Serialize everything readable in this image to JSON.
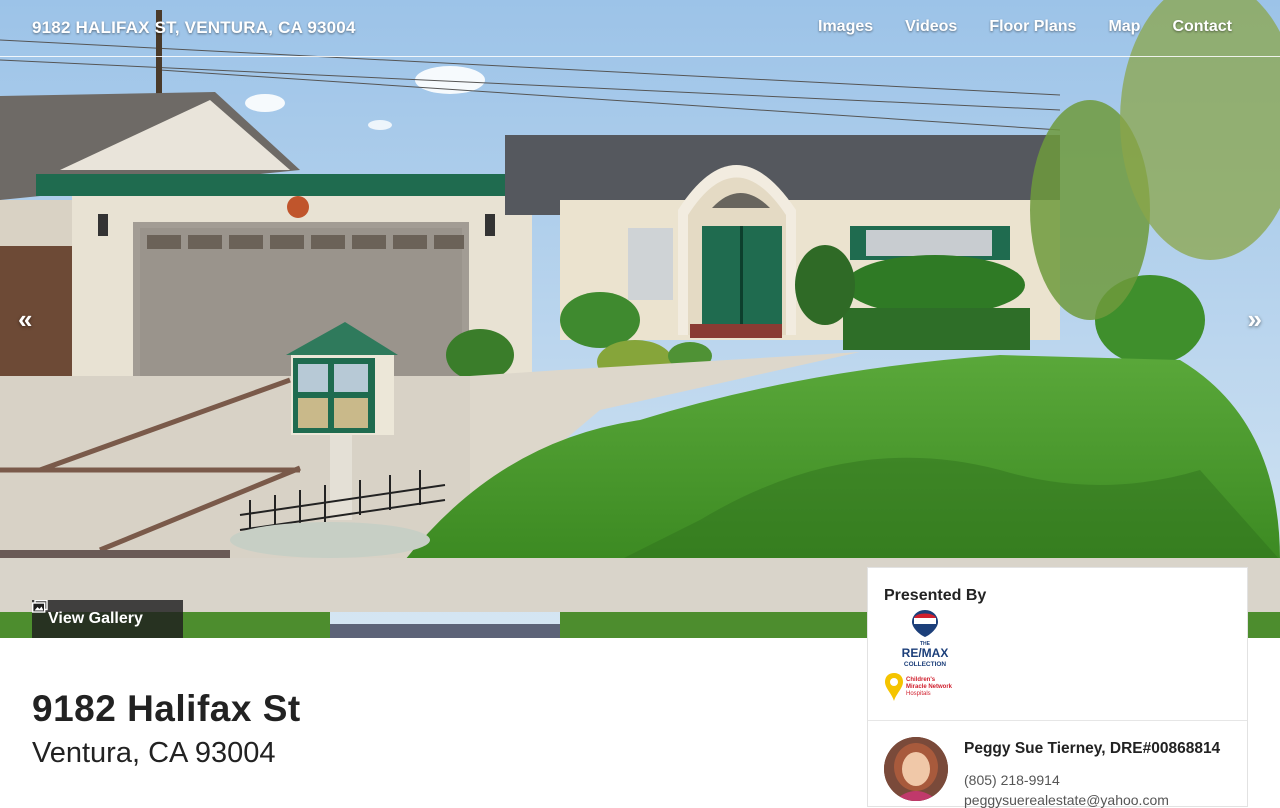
{
  "site": {
    "title": "9182 HALIFAX ST, VENTURA, CA 93004"
  },
  "nav": {
    "items": [
      "Images",
      "Videos",
      "Floor Plans",
      "Map",
      "Contact"
    ]
  },
  "hero": {
    "prev_icon": "chevron-double-left-icon",
    "next_icon": "chevron-double-right-icon",
    "gallery_label": "View Gallery",
    "gallery_icon": "images-icon"
  },
  "listing": {
    "street": "9182 Halifax St",
    "city_line": "Ventura, CA 93004"
  },
  "agent_card": {
    "title": "Presented By",
    "brokerage_logo_text": [
      "THE",
      "RE/MAX",
      "COLLECTION"
    ],
    "charity_logo_text": [
      "Children's",
      "Miracle Network",
      "Hospitals"
    ],
    "name": "Peggy Sue Tierney, DRE#00868814",
    "phone": "(805) 218-9914",
    "email": "peggysuerealestate@yahoo.com"
  },
  "colors": {
    "nav_text": "#ffffff",
    "button_bg": "#1e1e1e",
    "trim_green": "#1f6b4f",
    "remax_blue": "#1c3f7a",
    "remax_red": "#d0202e",
    "cmn_yellow": "#f5c400"
  }
}
